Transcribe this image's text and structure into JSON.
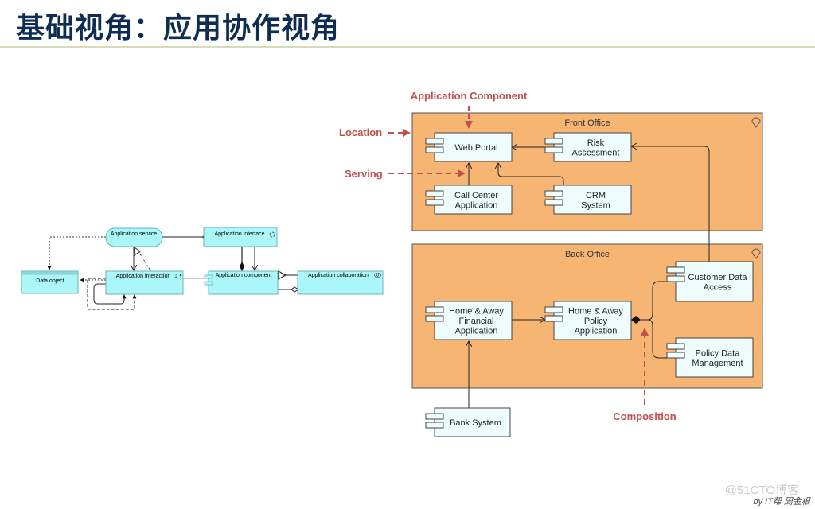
{
  "slide": {
    "title": "基础视角：应用协作视角",
    "watermark": "@51CTO博客",
    "byline": "by IT帮 周金根"
  },
  "metamodel": {
    "application_service": "Application service",
    "application_interface": "Application interface",
    "data_object": "Data object",
    "application_interaction": "Application interaction",
    "application_component": "Application component",
    "application_collaboration": "Application collaboration"
  },
  "example": {
    "groups": {
      "front_office": "Front Office",
      "back_office": "Back Office"
    },
    "components": {
      "web_portal": [
        "Web Portal"
      ],
      "risk_assessment": [
        "Risk",
        "Assessment"
      ],
      "call_center": [
        "Call Center",
        "Application"
      ],
      "crm_system": [
        "CRM",
        "System"
      ],
      "customer_data_access": [
        "Customer Data",
        "Access"
      ],
      "home_away_financial": [
        "Home & Away",
        "Financial",
        "Application"
      ],
      "home_away_policy": [
        "Home & Away",
        "Policy",
        "Application"
      ],
      "policy_data_mgmt": [
        "Policy Data",
        "Management"
      ],
      "bank_system": [
        "Bank System"
      ]
    },
    "annotations": {
      "application_component": "Application Component",
      "location": "Location",
      "serving": "Serving",
      "composition": "Composition"
    }
  },
  "colors": {
    "title": "#0f2d52",
    "annotation": "#c0504d",
    "group_fill": "#f7b574",
    "component_fill": "#effcfd",
    "metamodel_fill": "#aaf6f8"
  }
}
